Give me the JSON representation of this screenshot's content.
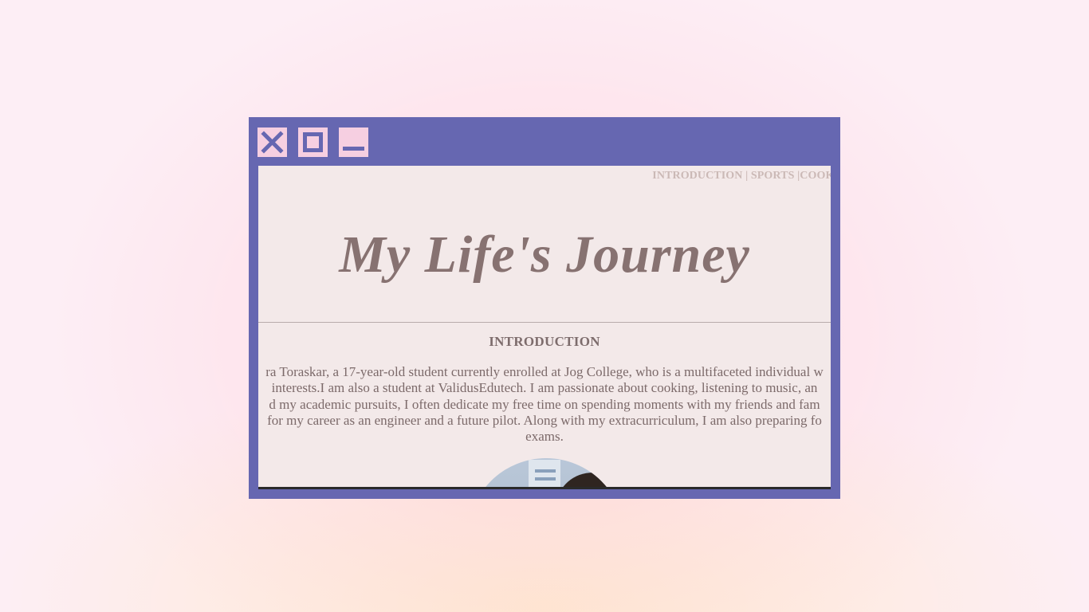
{
  "window": {
    "controls": {
      "close_icon": "close-icon",
      "maximize_icon": "maximize-icon",
      "minimize_icon": "minimize-icon"
    }
  },
  "nav": {
    "items": [
      "INTRODUCTION",
      "SPORTS",
      "COOKI"
    ],
    "separator": " | "
  },
  "page": {
    "title": "My Life's Journey",
    "section_heading": "INTRODUCTION",
    "intro_lines": [
      "ra Toraskar, a 17-year-old student currently enrolled at Jog College, who is a multifaceted individual w",
      "interests.I am also a student at ValidusEdutech. I am passionate about cooking, listening to music, an",
      "d my academic pursuits, I often dedicate my free time on spending moments with my friends and fam",
      "for my career as an engineer and a future pilot. Along with my extracurriculum, I am also preparing fo",
      "exams."
    ]
  },
  "colors": {
    "window_frame": "#6667b1",
    "control_bg": "#f6cfe1",
    "content_bg": "#f3e9e9",
    "title_text": "#877271",
    "nav_text": "#cbb9b6"
  }
}
